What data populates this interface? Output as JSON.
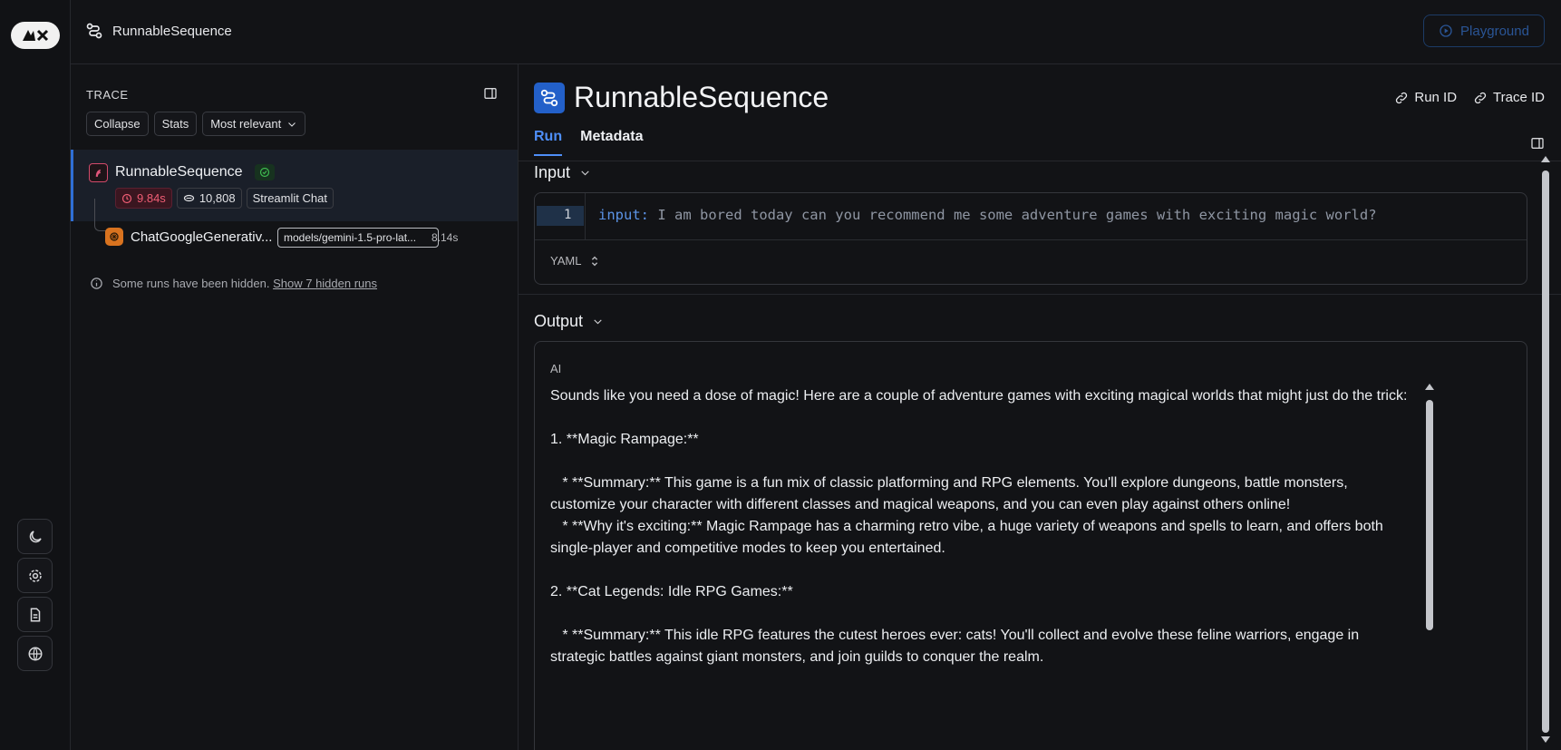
{
  "topbar": {
    "title": "RunnableSequence",
    "playground_label": "Playground"
  },
  "trace": {
    "heading": "TRACE",
    "chips": [
      "Collapse",
      "Stats",
      "Most relevant"
    ],
    "root_run": {
      "name": "RunnableSequence",
      "latency": "9.84s",
      "tokens": "10,808",
      "tag": "Streamlit Chat"
    },
    "child_run": {
      "name": "ChatGoogleGenerativ...",
      "model": "models/gemini-1.5-pro-lat...",
      "latency": "8.14s"
    },
    "hidden_note": "Some runs have been hidden.",
    "hidden_link": "Show 7 hidden runs"
  },
  "main": {
    "title": "RunnableSequence",
    "run_id_label": "Run ID",
    "trace_id_label": "Trace ID",
    "tabs": [
      "Run",
      "Metadata"
    ],
    "input_label": "Input",
    "input_line_no": "1",
    "input_key": "input:",
    "input_value": " I am bored today can you recommend me some adventure games with exciting magic world?",
    "format_label": "YAML",
    "output_label": "Output",
    "ai_label": "AI",
    "output_text": "Sounds like you need a dose of magic! Here are a couple of adventure games with exciting magical worlds that might just do the trick:\n\n1. **Magic Rampage:**\n\n   * **Summary:** This game is a fun mix of classic platforming and RPG elements. You'll explore dungeons, battle monsters, customize your character with different classes and magical weapons, and you can even play against others online!\n   * **Why it's exciting:** Magic Rampage has a charming retro vibe, a huge variety of weapons and spells to learn, and offers both single-player and competitive modes to keep you entertained.\n\n2. **Cat Legends: Idle RPG Games:**\n\n   * **Summary:** This idle RPG features the cutest heroes ever: cats! You'll collect and evolve these feline warriors, engage in strategic battles against giant monsters, and join guilds to conquer the realm."
  },
  "colors": {
    "accent": "#4e8ef7",
    "error": "#ef5d74",
    "success": "#3fb950",
    "background": "#121316"
  },
  "icons": [
    "logo-icon",
    "sequence-icon",
    "play-icon",
    "panel-toggle-icon",
    "chevron-down-icon",
    "check-circle-icon",
    "clock-icon",
    "token-icon",
    "parrot-icon",
    "openai-icon",
    "info-icon",
    "link-icon",
    "moon-icon",
    "gear-icon",
    "document-icon",
    "globe-icon",
    "updown-icon"
  ]
}
